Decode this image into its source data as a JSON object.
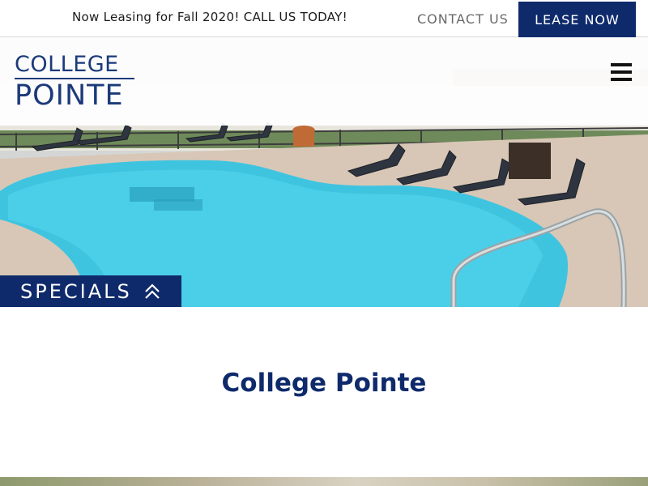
{
  "topbar": {
    "announcement": "Now Leasing for Fall 2020! CALL US TODAY!",
    "contact_label": "CONTACT US",
    "lease_label": "LEASE NOW"
  },
  "header": {
    "logo_line1": "COLLEGE",
    "logo_line2": "POINTE",
    "menu_icon": "hamburger-menu-icon"
  },
  "hero": {
    "specials_label": "SPECIALS",
    "specials_icon": "double-chevron-up-icon"
  },
  "main": {
    "title": "College Pointe"
  },
  "colors": {
    "brand_navy": "#0e2a6b",
    "pool_blue": "#3fc4e0",
    "text_gray": "#6a6a6a"
  }
}
